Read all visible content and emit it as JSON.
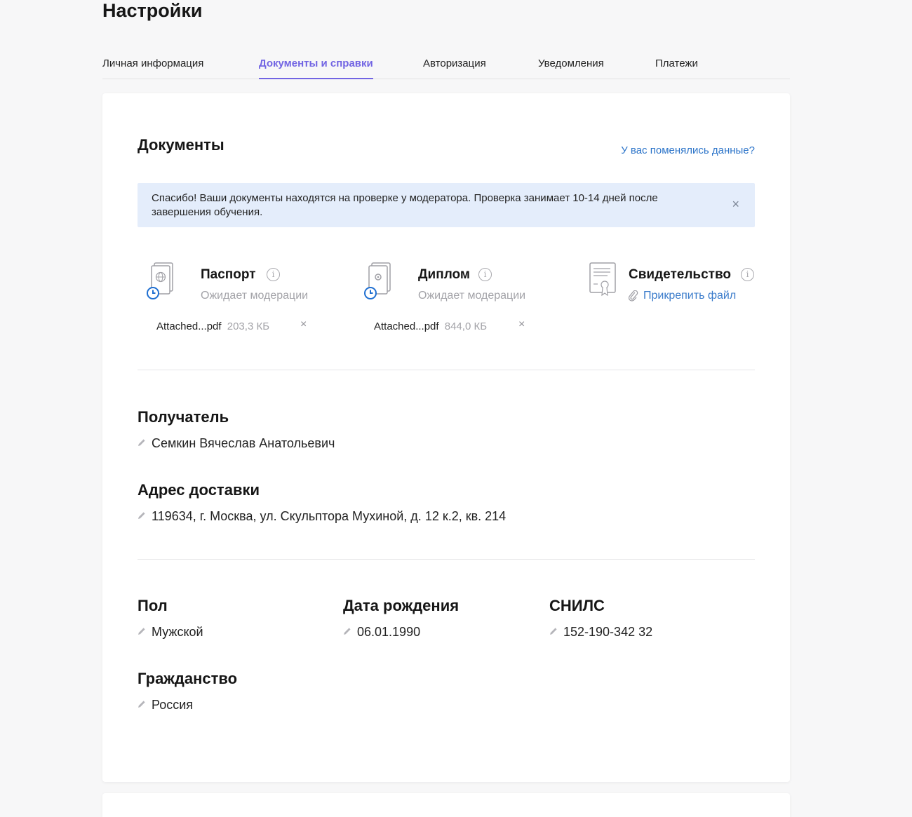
{
  "page": {
    "title": "Настройки"
  },
  "tabs": [
    {
      "label": "Личная информация"
    },
    {
      "label": "Документы и справки"
    },
    {
      "label": "Авторизация"
    },
    {
      "label": "Уведомления"
    },
    {
      "label": "Платежи"
    }
  ],
  "documents": {
    "title": "Документы",
    "changed_link": "У вас поменялись данные?",
    "notice": "Спасибо! Ваши документы находятся на проверке у модератора. Проверка занимает 10-14 дней после завершения обучения.",
    "notice_close": "×",
    "items": [
      {
        "name": "Паспорт",
        "status": "Ожидает модерации",
        "file_name": "Attached...pdf",
        "file_size": "203,3 КБ",
        "icon": "passport-icon"
      },
      {
        "name": "Диплом",
        "status": "Ожидает модерации",
        "file_name": "Attached...pdf",
        "file_size": "844,0 КБ",
        "icon": "diploma-icon"
      },
      {
        "name": "Свидетельство",
        "attach_label": "Прикрепить файл",
        "icon": "certificate-icon"
      }
    ],
    "remove_glyph": "×",
    "info_glyph": "i"
  },
  "fields": {
    "recipient": {
      "label": "Получатель",
      "value": "Семкин Вячеслав Анатольевич"
    },
    "address": {
      "label": "Адрес доставки",
      "value": "119634, г. Москва, ул. Скульптора Мухиной, д. 12 к.2, кв. 214"
    },
    "gender": {
      "label": "Пол",
      "value": "Мужской"
    },
    "birth_date": {
      "label": "Дата рождения",
      "value": "06.01.1990"
    },
    "snils": {
      "label": "СНИЛС",
      "value": "152-190-342 32"
    },
    "citizenship": {
      "label": "Гражданство",
      "value": "Россия"
    }
  },
  "colors": {
    "accent": "#7265e3",
    "link": "#2c74c9",
    "notice_bg": "#e4edfb",
    "pending_clock": "#1f6fd1"
  }
}
